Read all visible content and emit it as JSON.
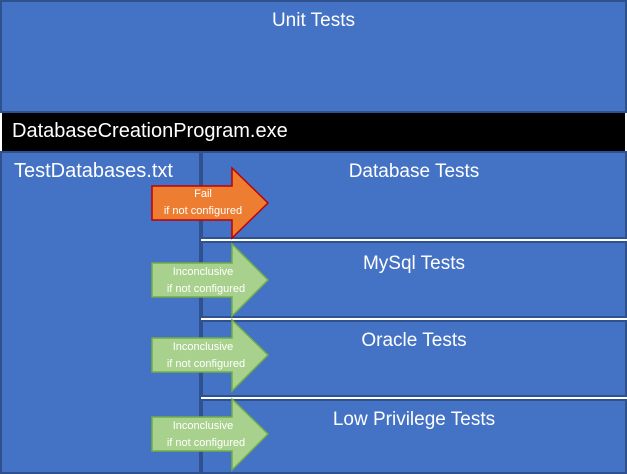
{
  "colors": {
    "box_fill": "#4472c4",
    "box_border": "#2f528f",
    "program_bar": "#000000",
    "fail_arrow": "#ed7d31",
    "fail_arrow_border": "#c00000",
    "inconclusive_arrow": "#a9d18e",
    "inconclusive_arrow_border": "#70ad47"
  },
  "unit_tests": {
    "title": "Unit Tests"
  },
  "program": {
    "label": "DatabaseCreationProgram.exe"
  },
  "config_file": {
    "label": "TestDatabases.txt"
  },
  "test_groups": [
    {
      "title": "Database Tests",
      "arrow": {
        "kind": "fail",
        "line1": "Fail",
        "line2": "if not configured"
      }
    },
    {
      "title": "MySql Tests",
      "arrow": {
        "kind": "inconclusive",
        "line1": "Inconclusive",
        "line2": "if not configured"
      }
    },
    {
      "title": "Oracle Tests",
      "arrow": {
        "kind": "inconclusive",
        "line1": "Inconclusive",
        "line2": "if not configured"
      }
    },
    {
      "title": "Low Privilege Tests",
      "arrow": {
        "kind": "inconclusive",
        "line1": "Inconclusive",
        "line2": "if not configured"
      }
    }
  ]
}
